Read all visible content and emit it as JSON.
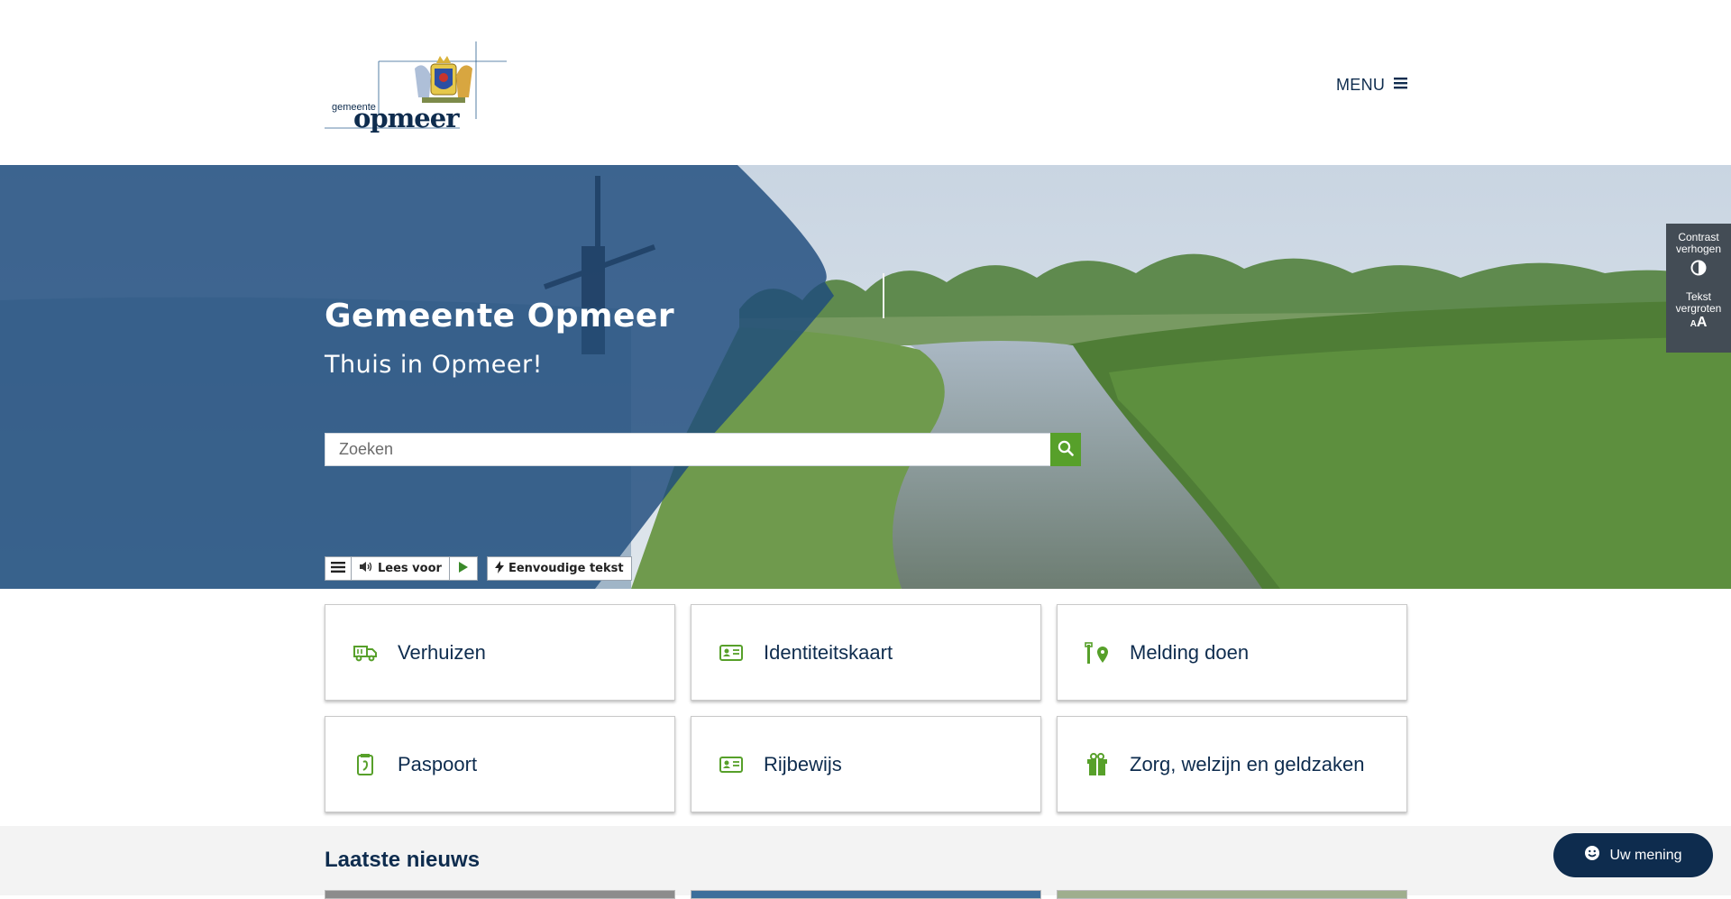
{
  "header": {
    "logo_small": "gemeente",
    "logo_large": "opmeer",
    "menu_label": "MENU"
  },
  "hero": {
    "title": "Gemeente Opmeer",
    "subtitle": "Thuis in Opmeer!",
    "search_placeholder": "Zoeken",
    "readspeaker": {
      "listen_label": "Lees voor",
      "simple_text_label": "Eenvoudige tekst"
    }
  },
  "accessibility": {
    "contrast_label_1": "Contrast",
    "contrast_label_2": "verhogen",
    "text_label_1": "Tekst",
    "text_label_2": "vergroten",
    "text_icon_small": "A",
    "text_icon_large": "A"
  },
  "tiles": [
    {
      "label": "Verhuizen",
      "icon": "moving-truck-icon"
    },
    {
      "label": "Identiteitskaart",
      "icon": "id-card-icon"
    },
    {
      "label": "Melding doen",
      "icon": "report-pin-icon"
    },
    {
      "label": "Paspoort",
      "icon": "passport-icon"
    },
    {
      "label": "Rijbewijs",
      "icon": "drivers-license-icon"
    },
    {
      "label": "Zorg, welzijn en geldzaken",
      "icon": "care-gift-icon"
    }
  ],
  "news": {
    "heading": "Laatste nieuws"
  },
  "feedback": {
    "label": "Uw mening"
  },
  "colors": {
    "navy": "#0e2c4e",
    "green": "#57a02a",
    "hero_overlay": "#1d4a7c",
    "panel": "#434c55"
  }
}
